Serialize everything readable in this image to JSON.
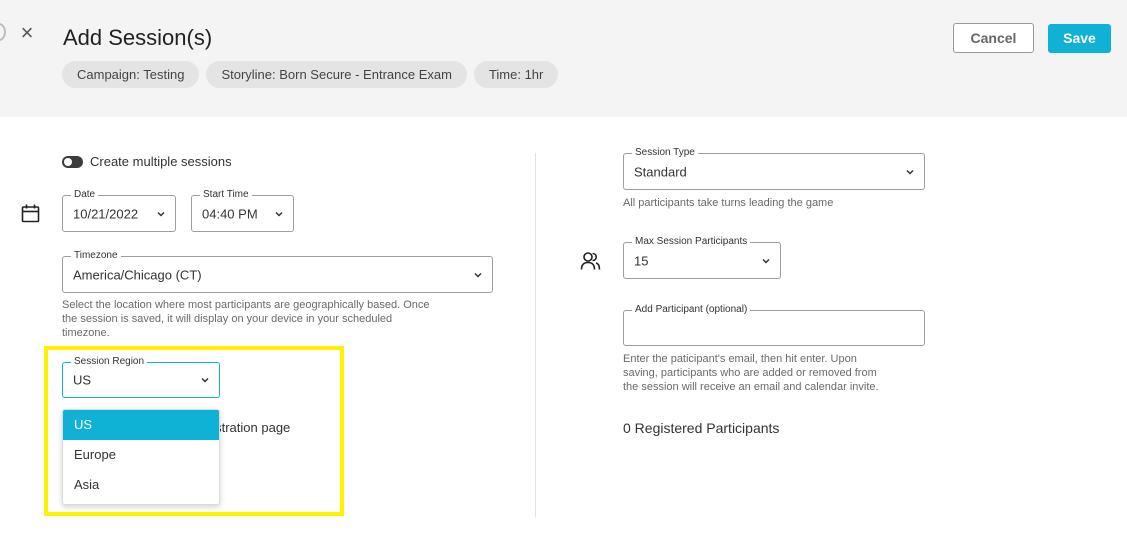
{
  "header": {
    "title": "Add Session(s)",
    "chips": [
      "Campaign: Testing",
      "Storyline: Born Secure - Entrance Exam",
      "Time: 1hr"
    ],
    "cancel_label": "Cancel",
    "save_label": "Save",
    "close_icon": "close-icon"
  },
  "left": {
    "multiple_sessions_label": "Create multiple sessions",
    "date": {
      "label": "Date",
      "value": "10/21/2022"
    },
    "start_time": {
      "label": "Start Time",
      "value": "04:40 PM"
    },
    "timezone": {
      "label": "Timezone",
      "value": "America/Chicago (CT)",
      "help_line1": "Select the location where most participants are geographically based. Once",
      "help_line2": "the session is saved, it will display on your device in your scheduled",
      "help_line3": "timezone."
    },
    "session_region": {
      "label": "Session Region",
      "value": "US",
      "options": [
        "US",
        "Europe",
        "Asia"
      ]
    },
    "registration_partial": "gistration page"
  },
  "right": {
    "session_type": {
      "label": "Session Type",
      "value": "Standard",
      "help": "All participants take turns leading the game"
    },
    "max_participants": {
      "label": "Max Session Participants",
      "value": "15"
    },
    "add_participant": {
      "label": "Add Participant (optional)",
      "value": "",
      "help_line1": "Enter the paticipant's email, then hit enter. Upon",
      "help_line2": "saving, participants who are added or removed from",
      "help_line3": "the session will receive an email and calendar invite."
    },
    "registered_count": "0 Registered Participants"
  },
  "colors": {
    "accent": "#0fb1d5",
    "highlight": "#fff200"
  }
}
